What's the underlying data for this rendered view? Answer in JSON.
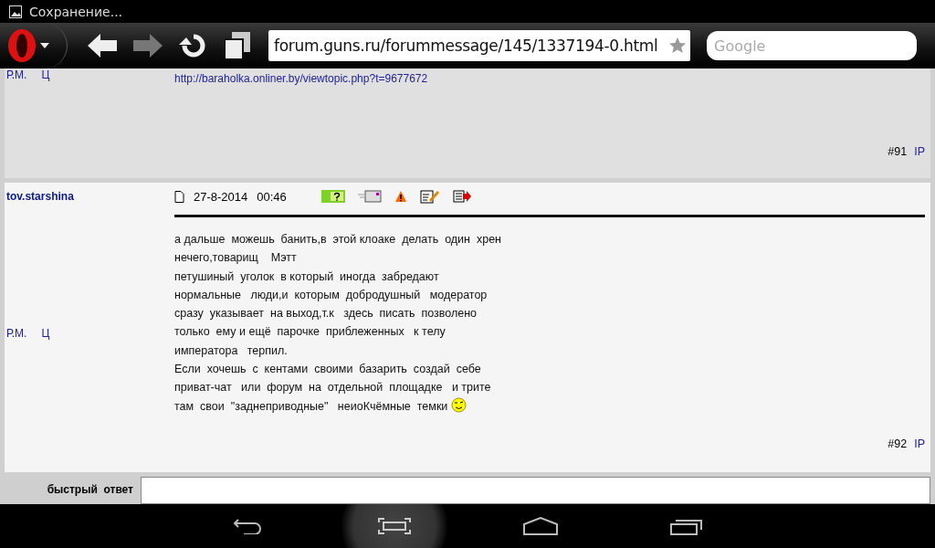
{
  "status_bar": {
    "notification": "Сохранение..."
  },
  "toolbar": {
    "url": "forum.guns.ru/forummessage/145/1337194-0.html",
    "search_placeholder": "Google"
  },
  "posts": [
    {
      "profile_links": [
        "Р.М.",
        "Ц"
      ],
      "body_link": "http://baraholka.onliner.by/viewtopic.php?t=9677672",
      "number": "#91",
      "ip_link": "IP"
    },
    {
      "author": "tov.starshina",
      "date": "27-8-2014",
      "time": "00:46",
      "profile_links": [
        "Р.М.",
        "Ц"
      ],
      "body": "а дальше  можешь  банить,в  этой клоаке  делать  один  хрен\nнечего,товарищ    Мэтт\nпетушиный  уголок  в который  иногда  забредают\nнормальные   люди,и  которым  добродушный   модератор\nсразу  указывает  на выход,т.к   здесь  писать  позволено\nтолько  ему и ещё  парочке  приблеженных   к телу\nимператора   терпил.\nЕсли  хочешь  с  кентами  своими  базарить  создай  себе\nприват-чат   или  форум  на  отдельной  площадке   и трите\nтам  свои  \"заднеприводные\"   неиоКчёмные  темки",
      "emoticon_at_end": true,
      "number": "#92",
      "ip_link": "IP"
    }
  ],
  "quick_reply": {
    "label": "быстрый  ответ"
  }
}
